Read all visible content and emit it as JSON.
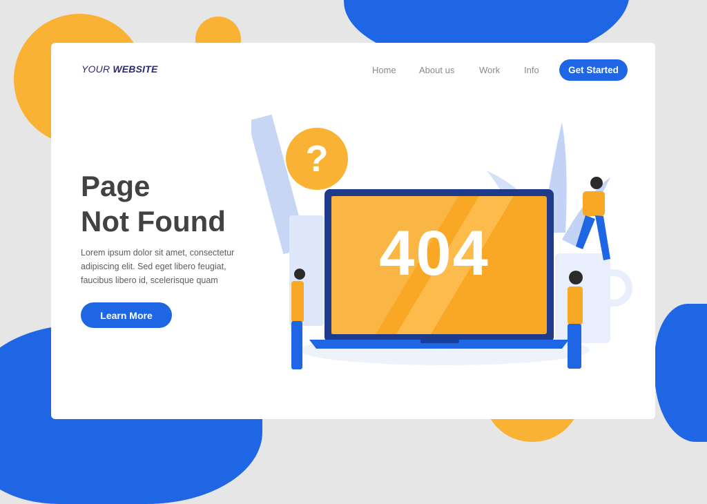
{
  "header": {
    "logo_prefix": "YOUR",
    "logo_bold": "WEBSITE",
    "nav": [
      "Home",
      "About us",
      "Work",
      "Info"
    ],
    "cta_label": "Get Started"
  },
  "hero": {
    "title_line1": "Page",
    "title_line2": "Not Found",
    "description": "Lorem ipsum dolor sit amet, consectetur adipiscing elit. Sed eget libero feugiat, faucibus libero id, scelerisque quam",
    "button_label": "Learn More"
  },
  "illustration": {
    "error_code": "404",
    "question_mark": "?"
  },
  "colors": {
    "accent_blue": "#1f66e5",
    "accent_orange": "#f9b233",
    "text_dark": "#424242",
    "logo": "#2c2a6d"
  }
}
